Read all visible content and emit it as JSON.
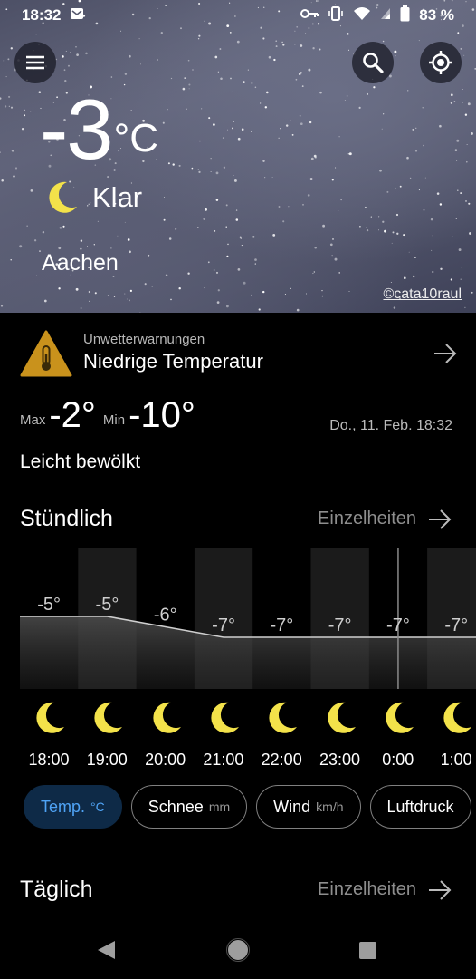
{
  "status": {
    "time": "18:32",
    "battery": "83 %"
  },
  "current": {
    "temp": "-3",
    "unit": "°C",
    "condition": "Klar",
    "city": "Aachen",
    "photo_credit": "©cata10raul"
  },
  "warning": {
    "label": "Unwetterwarnungen",
    "title": "Niedrige Temperatur"
  },
  "summary": {
    "max_label": "Max",
    "max": "-2°",
    "min_label": "Min",
    "min": "-10°",
    "datetime": "Do., 11. Feb. 18:32",
    "description": "Leicht bewölkt"
  },
  "hourly": {
    "title": "Stündlich",
    "details": "Einzelheiten",
    "items": [
      {
        "time": "18:00",
        "temp": "-5°",
        "value": -5
      },
      {
        "time": "19:00",
        "temp": "-5°",
        "value": -5
      },
      {
        "time": "20:00",
        "temp": "-6°",
        "value": -6
      },
      {
        "time": "21:00",
        "temp": "-7°",
        "value": -7
      },
      {
        "time": "22:00",
        "temp": "-7°",
        "value": -7
      },
      {
        "time": "23:00",
        "temp": "-7°",
        "value": -7
      },
      {
        "time": "0:00",
        "temp": "-7°",
        "value": -7
      },
      {
        "time": "1:00",
        "temp": "-7°",
        "value": -7
      }
    ]
  },
  "chips": [
    {
      "label": "Temp.",
      "unit": "°C",
      "active": true
    },
    {
      "label": "Schnee",
      "unit": "mm",
      "active": false
    },
    {
      "label": "Wind",
      "unit": "km/h",
      "active": false
    },
    {
      "label": "Luftdruck",
      "unit": "",
      "active": false
    }
  ],
  "daily": {
    "title": "Täglich",
    "details": "Einzelheiten"
  },
  "colors": {
    "accent": "#4fa3f5",
    "moon": "#f3e24a",
    "warning": "#c9921c"
  }
}
